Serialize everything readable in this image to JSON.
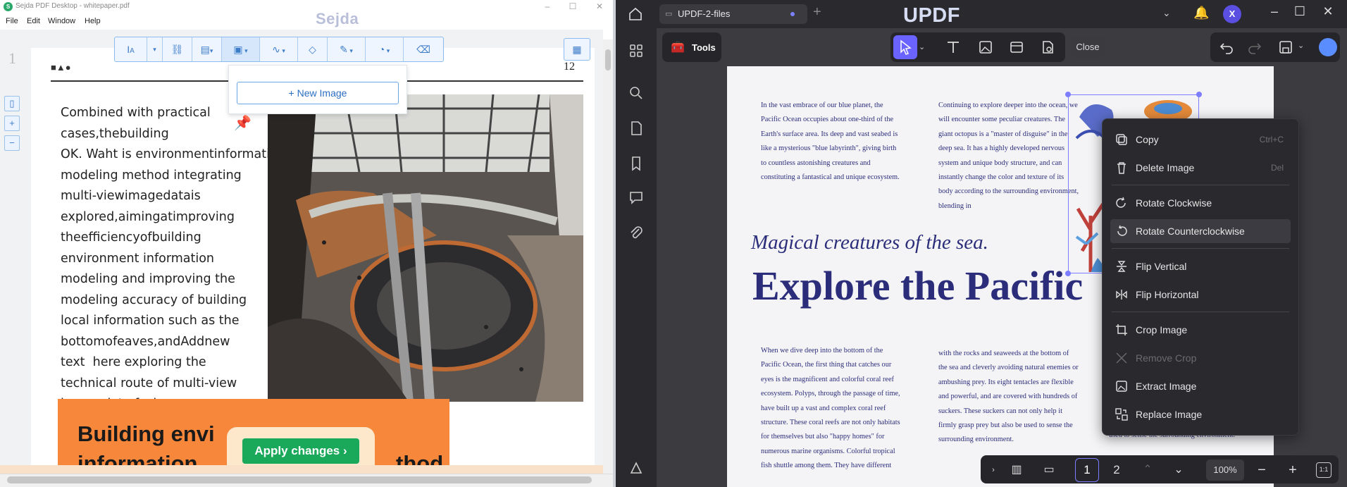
{
  "sejda": {
    "window_title": "Sejda PDF Desktop - whitepaper.pdf",
    "menu": [
      "File",
      "Edit",
      "Window",
      "Help"
    ],
    "brand": "Sejda",
    "page_margin_number": "1",
    "page_number": "12",
    "header_shapes": "■▲●",
    "body_lines": [
      "Combined with practical",
      "cases,thebuilding",
      "OK. Waht is environmentinformation",
      "modeling method integrating",
      "multi-viewimagedatais",
      "explored,aimingatimproving",
      "theefficiencyofbuilding",
      "environment information",
      "modeling and improving the",
      "modeling accuracy of building",
      "local information such as the",
      "bottomofeaves,andAddnew",
      "text  here exploring the",
      "technical route of multi-view",
      "image data fusion."
    ],
    "orange_heading_1": "Building envi",
    "orange_heading_2": "information",
    "orange_heading_2b": "thod",
    "new_image_label": "New Image",
    "apply_changes_label": "Apply changes",
    "toolbar_icons": [
      "text-icon",
      "link-icon",
      "forms-icon",
      "image-icon",
      "signature-icon",
      "eraser-icon",
      "annotate-icon",
      "shapes-icon",
      "delete-icon"
    ]
  },
  "updf": {
    "tab_title": "UPDF-2-files",
    "brand": "UPDF",
    "avatar_initial": "X",
    "tools_label": "Tools",
    "close_label": "Close",
    "col1": "In the vast embrace of our blue planet, the Pacific Ocean occupies about one-third of the Earth's surface area. Its deep and vast seabed is like a mysterious \"blue labyrinth\", giving birth to countless astonishing creatures and constituting a fantastical and unique ecosystem.",
    "col2": "Continuing to explore deeper into the ocean, we will encounter some peculiar creatures. The giant octopus is a \"master of disguise\" in the deep sea. It has a highly developed nervous system and unique body structure, and can instantly change the color and texture of its body according to the surrounding environment, blending in",
    "subtitle": "Magical creatures of the sea.",
    "title": "Explore the Pacific",
    "col3": "When we dive deep into the bottom of the Pacific Ocean, the first thing that catches our eyes is the magnificent and colorful coral reef ecosystem. Polyps, through the passage of time, have built up a vast and complex coral reef structure. These coral reefs are not only habitats for themselves but also \"happy homes\" for numerous marine organisms. Colorful tropical fish shuttle among them. They have different",
    "col4": "with the rocks and seaweeds at the bottom of the sea and cleverly avoiding natural enemies or ambushing prey. Its eight tentacles are flexible and powerful, and are covered with hundreds of suckers. These suckers can not only help it firmly grasp prey but also be used to sense the surrounding environment.",
    "col4_tail": "used to sense the surrounding environment.",
    "context_menu": [
      {
        "label": "Copy",
        "shortcut": "Ctrl+C",
        "icon": "copy-icon"
      },
      {
        "label": "Delete Image",
        "shortcut": "Del",
        "icon": "trash-icon"
      },
      {
        "label": "Rotate Clockwise",
        "shortcut": "",
        "icon": "rotate-cw-icon"
      },
      {
        "label": "Rotate Counterclockwise",
        "shortcut": "",
        "icon": "rotate-ccw-icon"
      },
      {
        "label": "Flip Vertical",
        "shortcut": "",
        "icon": "flip-vertical-icon"
      },
      {
        "label": "Flip Horizontal",
        "shortcut": "",
        "icon": "flip-horizontal-icon"
      },
      {
        "label": "Crop Image",
        "shortcut": "",
        "icon": "crop-icon"
      },
      {
        "label": "Remove Crop",
        "shortcut": "",
        "icon": "remove-crop-icon"
      },
      {
        "label": "Extract Image",
        "shortcut": "",
        "icon": "extract-icon"
      },
      {
        "label": "Replace Image",
        "shortcut": "",
        "icon": "replace-icon"
      }
    ],
    "page1": "1",
    "page2": "2",
    "zoom": "100%",
    "fit_label": "1:1"
  }
}
